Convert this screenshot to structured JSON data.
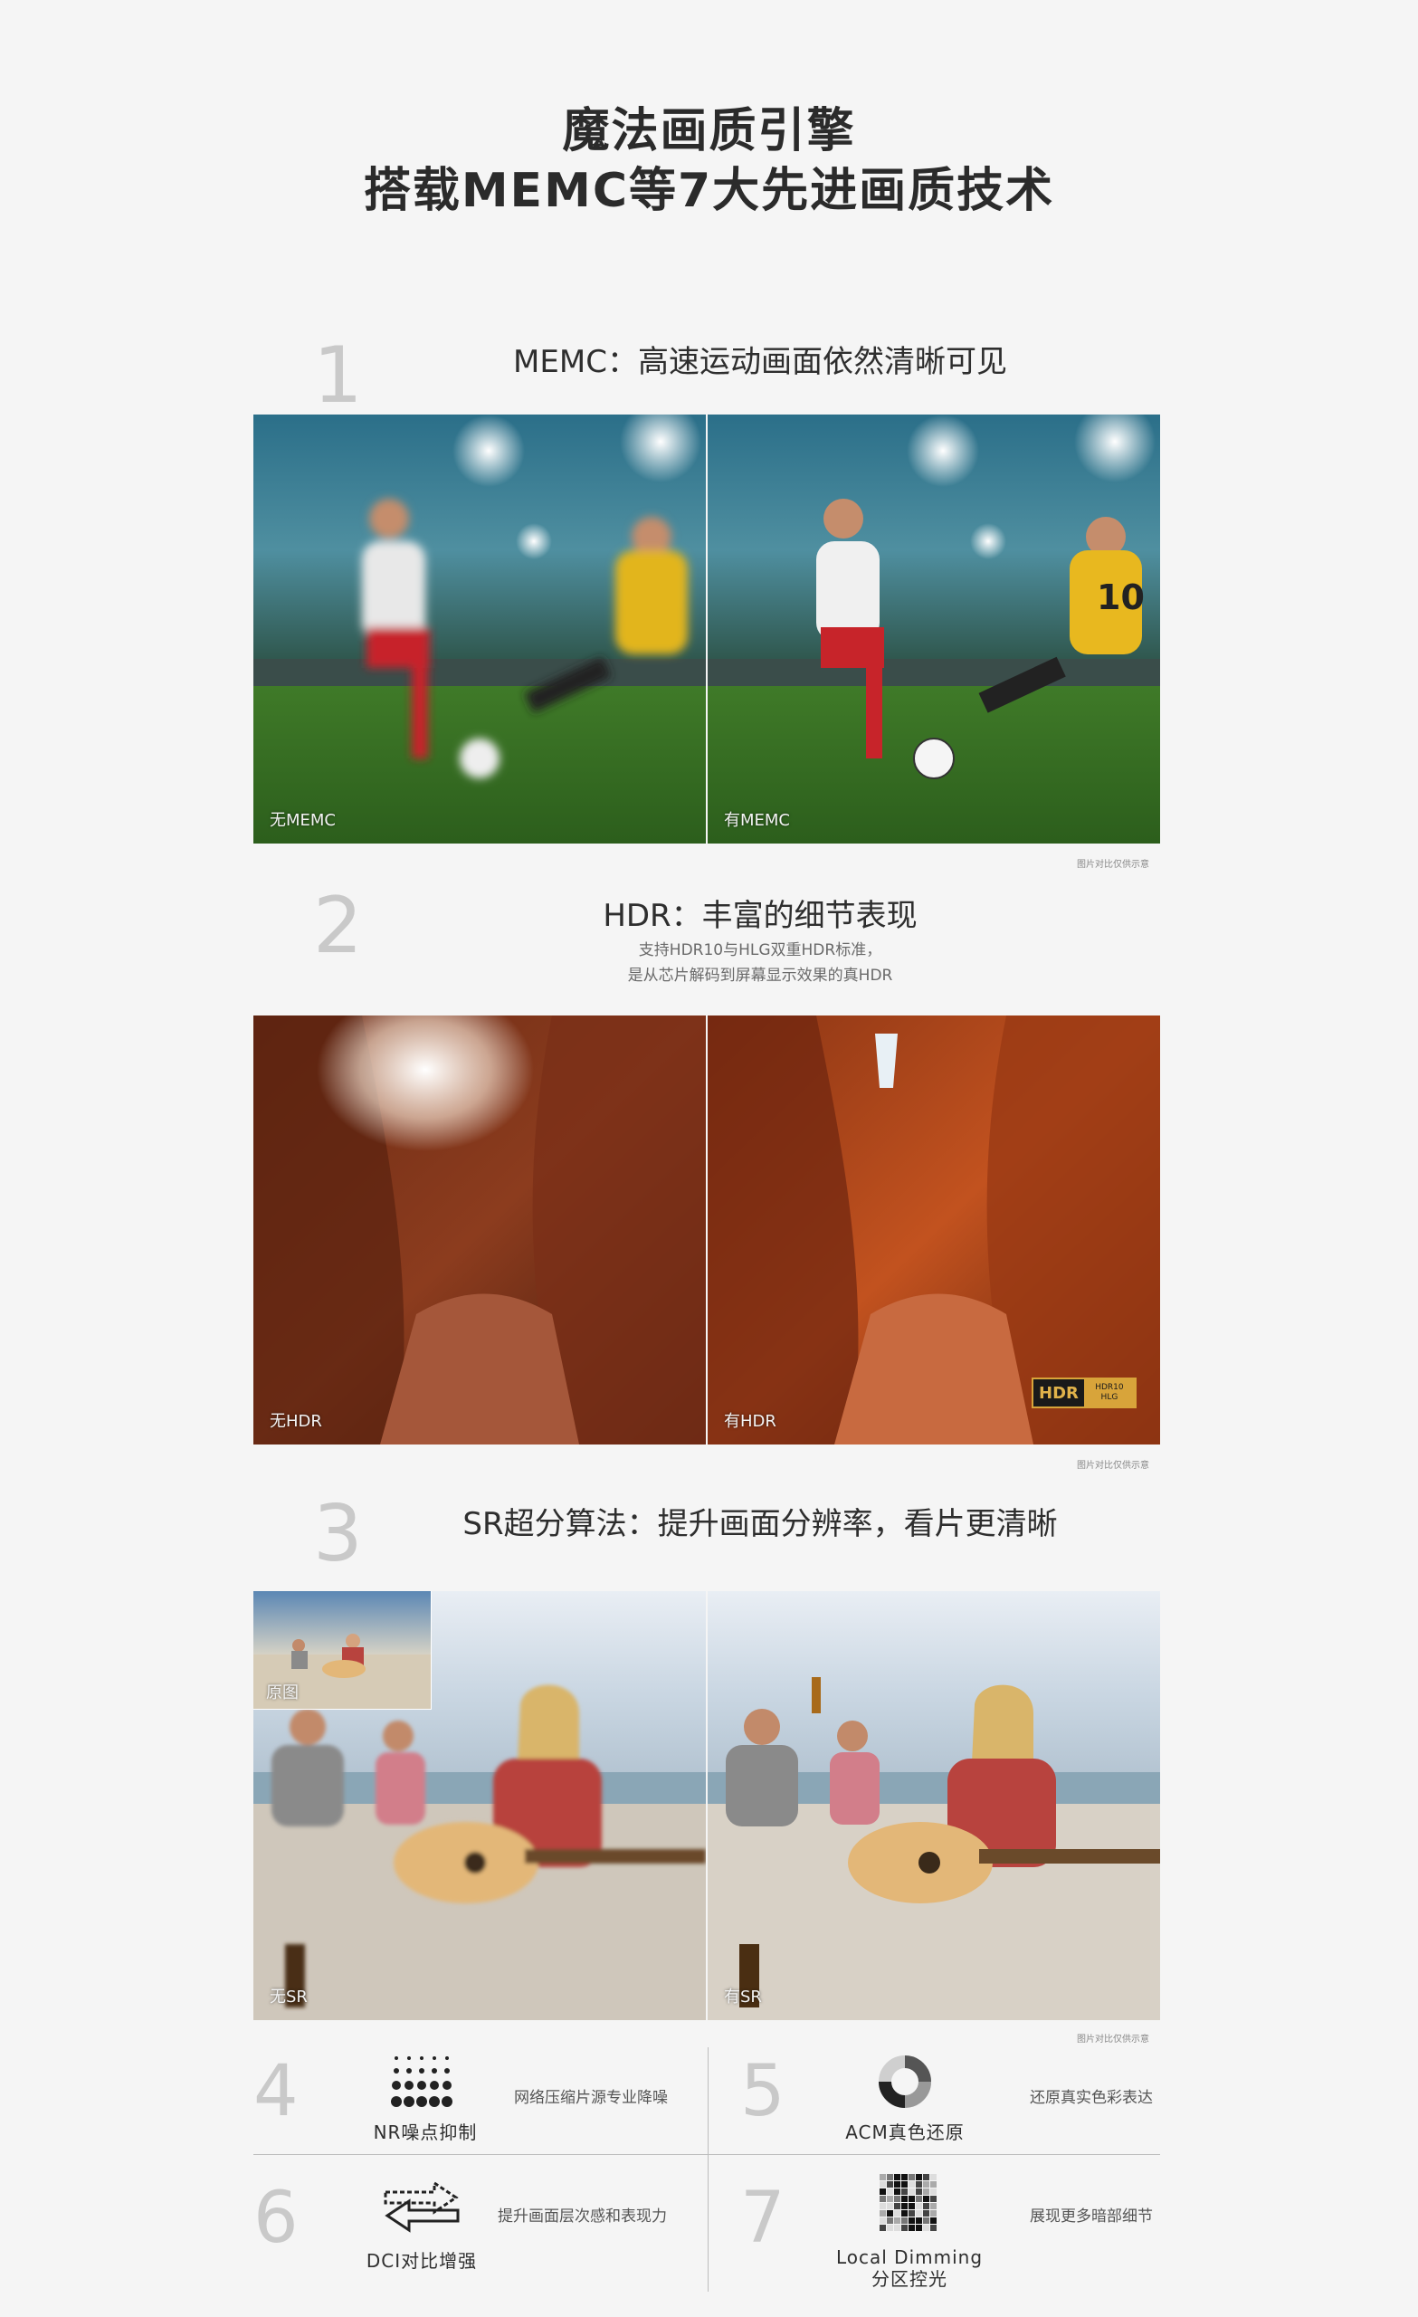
{
  "header": {
    "line1": "魔法画质引擎",
    "line2": "搭载MEMC等7大先进画质技术"
  },
  "sections": [
    {
      "num": "1",
      "heading": "MEMC：高速运动画面依然清晰可见",
      "left_label": "无MEMC",
      "right_label": "有MEMC",
      "note": "图片对比仅供示意"
    },
    {
      "num": "2",
      "heading": "HDR：丰富的细节表现",
      "sub1": "支持HDR10与HLG双重HDR标准，",
      "sub2": "是从芯片解码到屏幕显示效果的真HDR",
      "left_label": "无HDR",
      "right_label": "有HDR",
      "badge_main": "HDR",
      "badge_top": "HDR10",
      "badge_bottom": "HLG",
      "note": "图片对比仅供示意"
    },
    {
      "num": "3",
      "heading": "SR超分算法：提升画面分辨率，看片更清晰",
      "inset_label": "原图",
      "left_label": "无SR",
      "right_label": "有SR",
      "note": "图片对比仅供示意"
    }
  ],
  "features": [
    {
      "num": "4",
      "label": "NR噪点抑制",
      "desc": "网络压缩片源专业降噪",
      "icon": "dots-grid-icon"
    },
    {
      "num": "5",
      "label": "ACM真色还原",
      "desc": "还原真实色彩表达",
      "icon": "color-ring-icon"
    },
    {
      "num": "6",
      "label": "DCI对比增强",
      "desc": "提升画面层次感和表现力",
      "icon": "swap-arrows-icon"
    },
    {
      "num": "7",
      "label": "Local Dimming",
      "label2": "分区控光",
      "desc": "展现更多暗部细节",
      "icon": "pixel-grid-icon"
    }
  ]
}
